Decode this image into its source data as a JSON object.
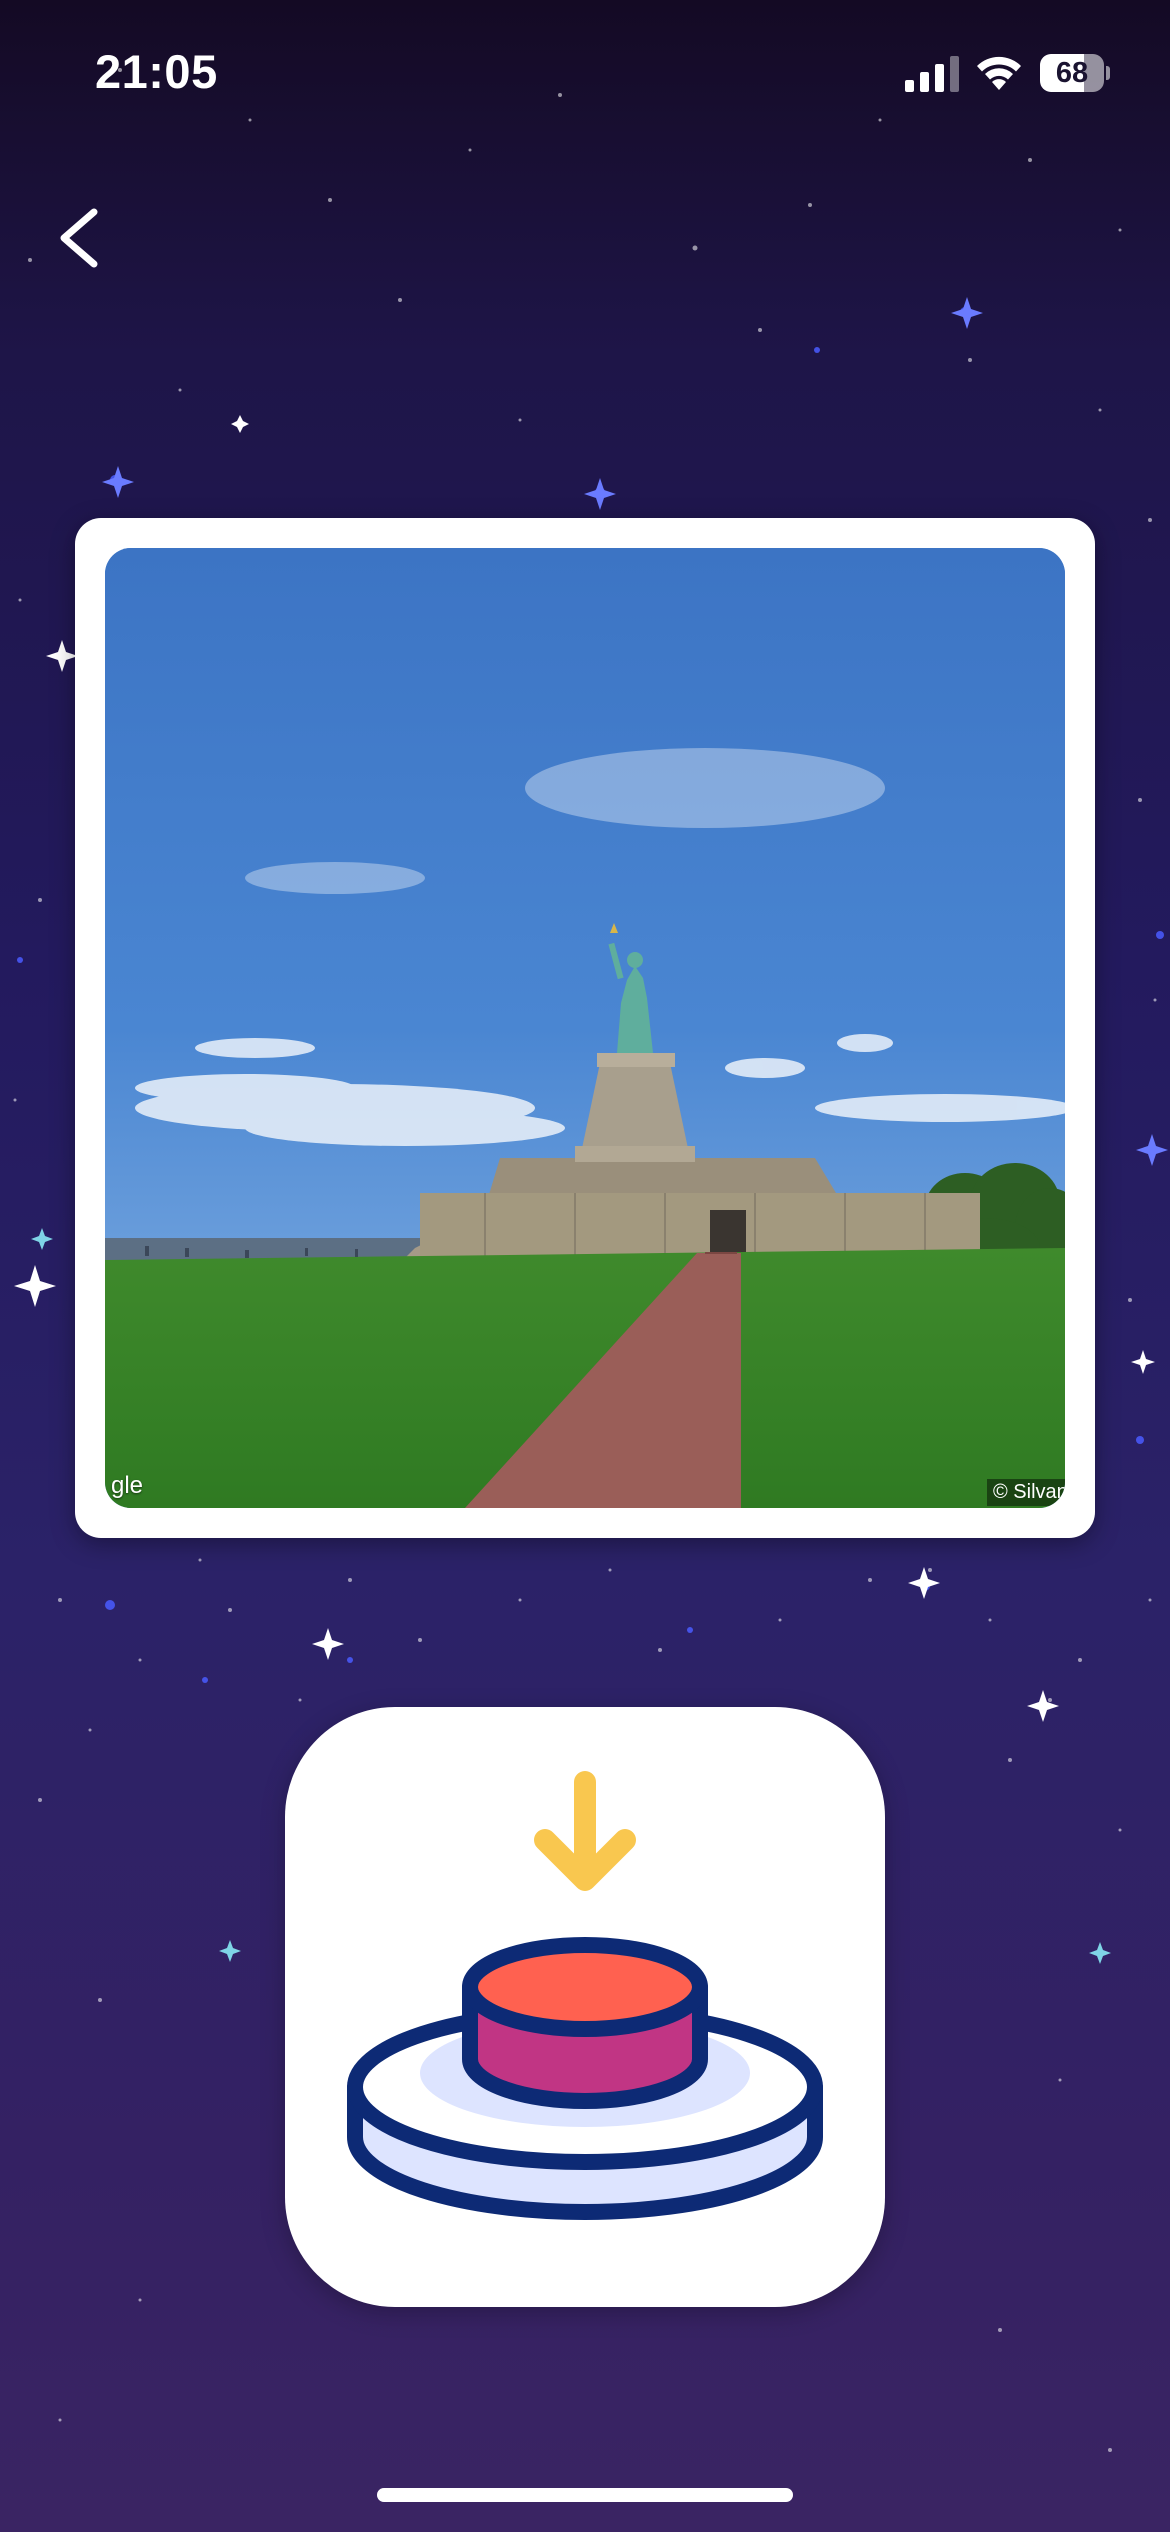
{
  "status_bar": {
    "time": "21:05",
    "battery_level": "68",
    "icons": [
      "cell-signal-icon",
      "wifi-icon",
      "battery-icon"
    ]
  },
  "navigation": {
    "back_icon": "chevron-left-icon"
  },
  "photo": {
    "subject": "Statue of Liberty street view",
    "credit_left": "gle",
    "credit_right": "© Silvan"
  },
  "drop_button": {
    "icon": "press-button-icon",
    "arrow_icon": "arrow-down-icon"
  },
  "colors": {
    "background_top": "#140a24",
    "background_bottom": "#3a2463",
    "arrow": "#f9c74f",
    "button_top": "#ff6150",
    "button_side": "#c13584",
    "outline": "#0d2a75",
    "base": "#dde4ff"
  }
}
